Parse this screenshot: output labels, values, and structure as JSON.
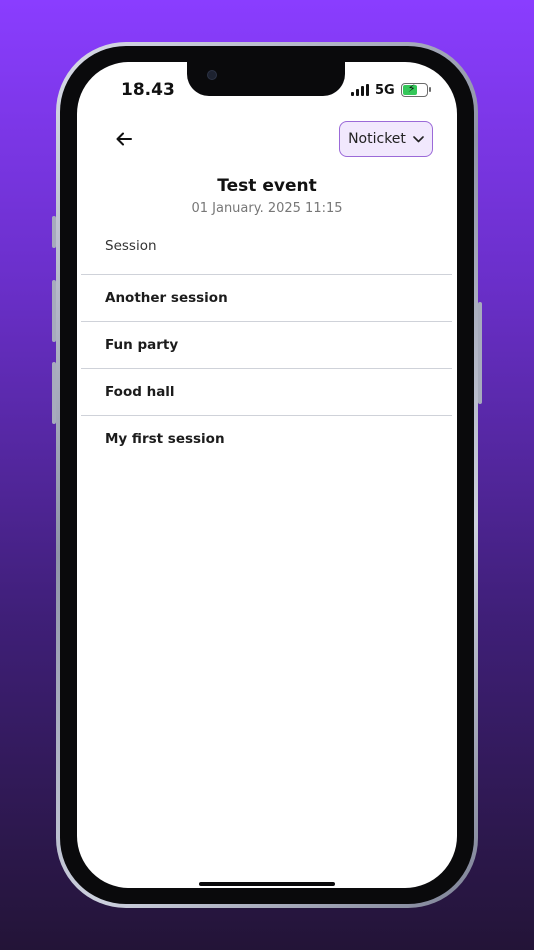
{
  "status_bar": {
    "time": "18.43",
    "network": "5G"
  },
  "header": {
    "ticket_select": {
      "selected": "Noticket"
    }
  },
  "event": {
    "title": "Test event",
    "datetime": "01 January. 2025 11:15"
  },
  "sessions": {
    "heading": "Session",
    "items": [
      "Another session",
      "Fun party",
      "Food hall",
      "My first session"
    ]
  },
  "colors": {
    "accent_border": "#9b6ad8",
    "accent_bg": "#f1e8fd",
    "background_top": "#8a3dff"
  },
  "icons": {
    "back": "arrow-left-icon",
    "dropdown": "chevron-down-icon"
  }
}
